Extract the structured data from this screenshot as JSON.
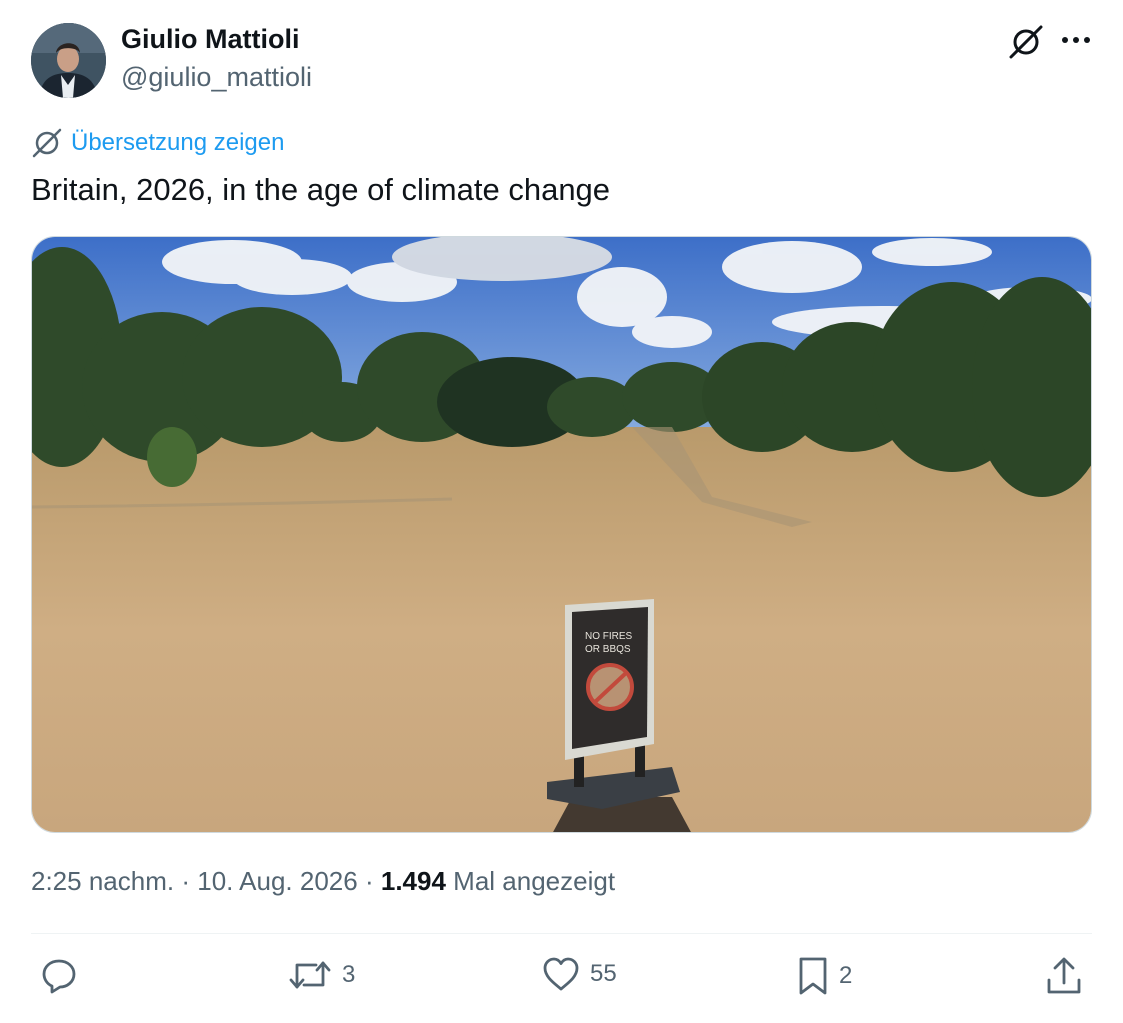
{
  "author": {
    "name": "Giulio Mattioli",
    "handle": "@giulio_mattioli"
  },
  "header_icons": [
    "no-translate-icon",
    "more-icon"
  ],
  "translate_label": "Übersetzung zeigen",
  "tweet_text": "Britain, 2026, in the age of climate change",
  "media": {
    "sign_line1": "NO FIRES",
    "sign_line2": "OR BBQS"
  },
  "meta": {
    "time": "2:25 nachm.",
    "separator": "·",
    "date": "10. Aug. 2026",
    "views_count": "1.494",
    "views_label": "Mal angezeigt"
  },
  "actions": {
    "reply_count": "",
    "retweet_count": "3",
    "like_count": "55",
    "bookmark_count": "2"
  },
  "colors": {
    "link": "#1d9bf0",
    "secondary": "#536471",
    "primary": "#0f1419"
  }
}
